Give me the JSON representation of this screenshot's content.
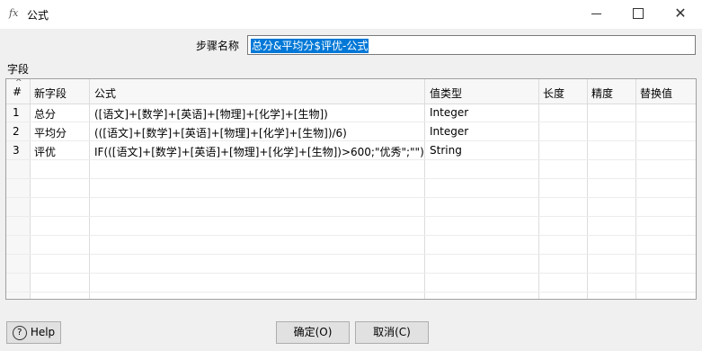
{
  "window": {
    "icon": "fx-icon",
    "title": "公式",
    "controls": {
      "minimize": "minimize-icon",
      "maximize": "maximize-icon",
      "close": "close-icon"
    }
  },
  "step": {
    "label": "步骤名称",
    "value": "总分&平均分$评优-公式"
  },
  "fields": {
    "label": "字段",
    "columns": [
      "#",
      "新字段",
      "公式",
      "值类型",
      "长度",
      "精度",
      "替换值"
    ],
    "rows": [
      {
        "num": "1",
        "name": "总分",
        "formula": "([语文]+[数学]+[英语]+[物理]+[化学]+[生物])",
        "type": "Integer",
        "length": "",
        "precision": "",
        "replace": ""
      },
      {
        "num": "2",
        "name": "平均分",
        "formula": "(([语文]+[数学]+[英语]+[物理]+[化学]+[生物])/6)",
        "type": "Integer",
        "length": "",
        "precision": "",
        "replace": ""
      },
      {
        "num": "3",
        "name": "评优",
        "formula": "IF(([语文]+[数学]+[英语]+[物理]+[化学]+[生物])>600;\"优秀\";\"\")",
        "type": "String",
        "length": "",
        "precision": "",
        "replace": ""
      }
    ]
  },
  "buttons": {
    "help": "Help",
    "ok": "确定(O)",
    "cancel": "取消(C)"
  }
}
